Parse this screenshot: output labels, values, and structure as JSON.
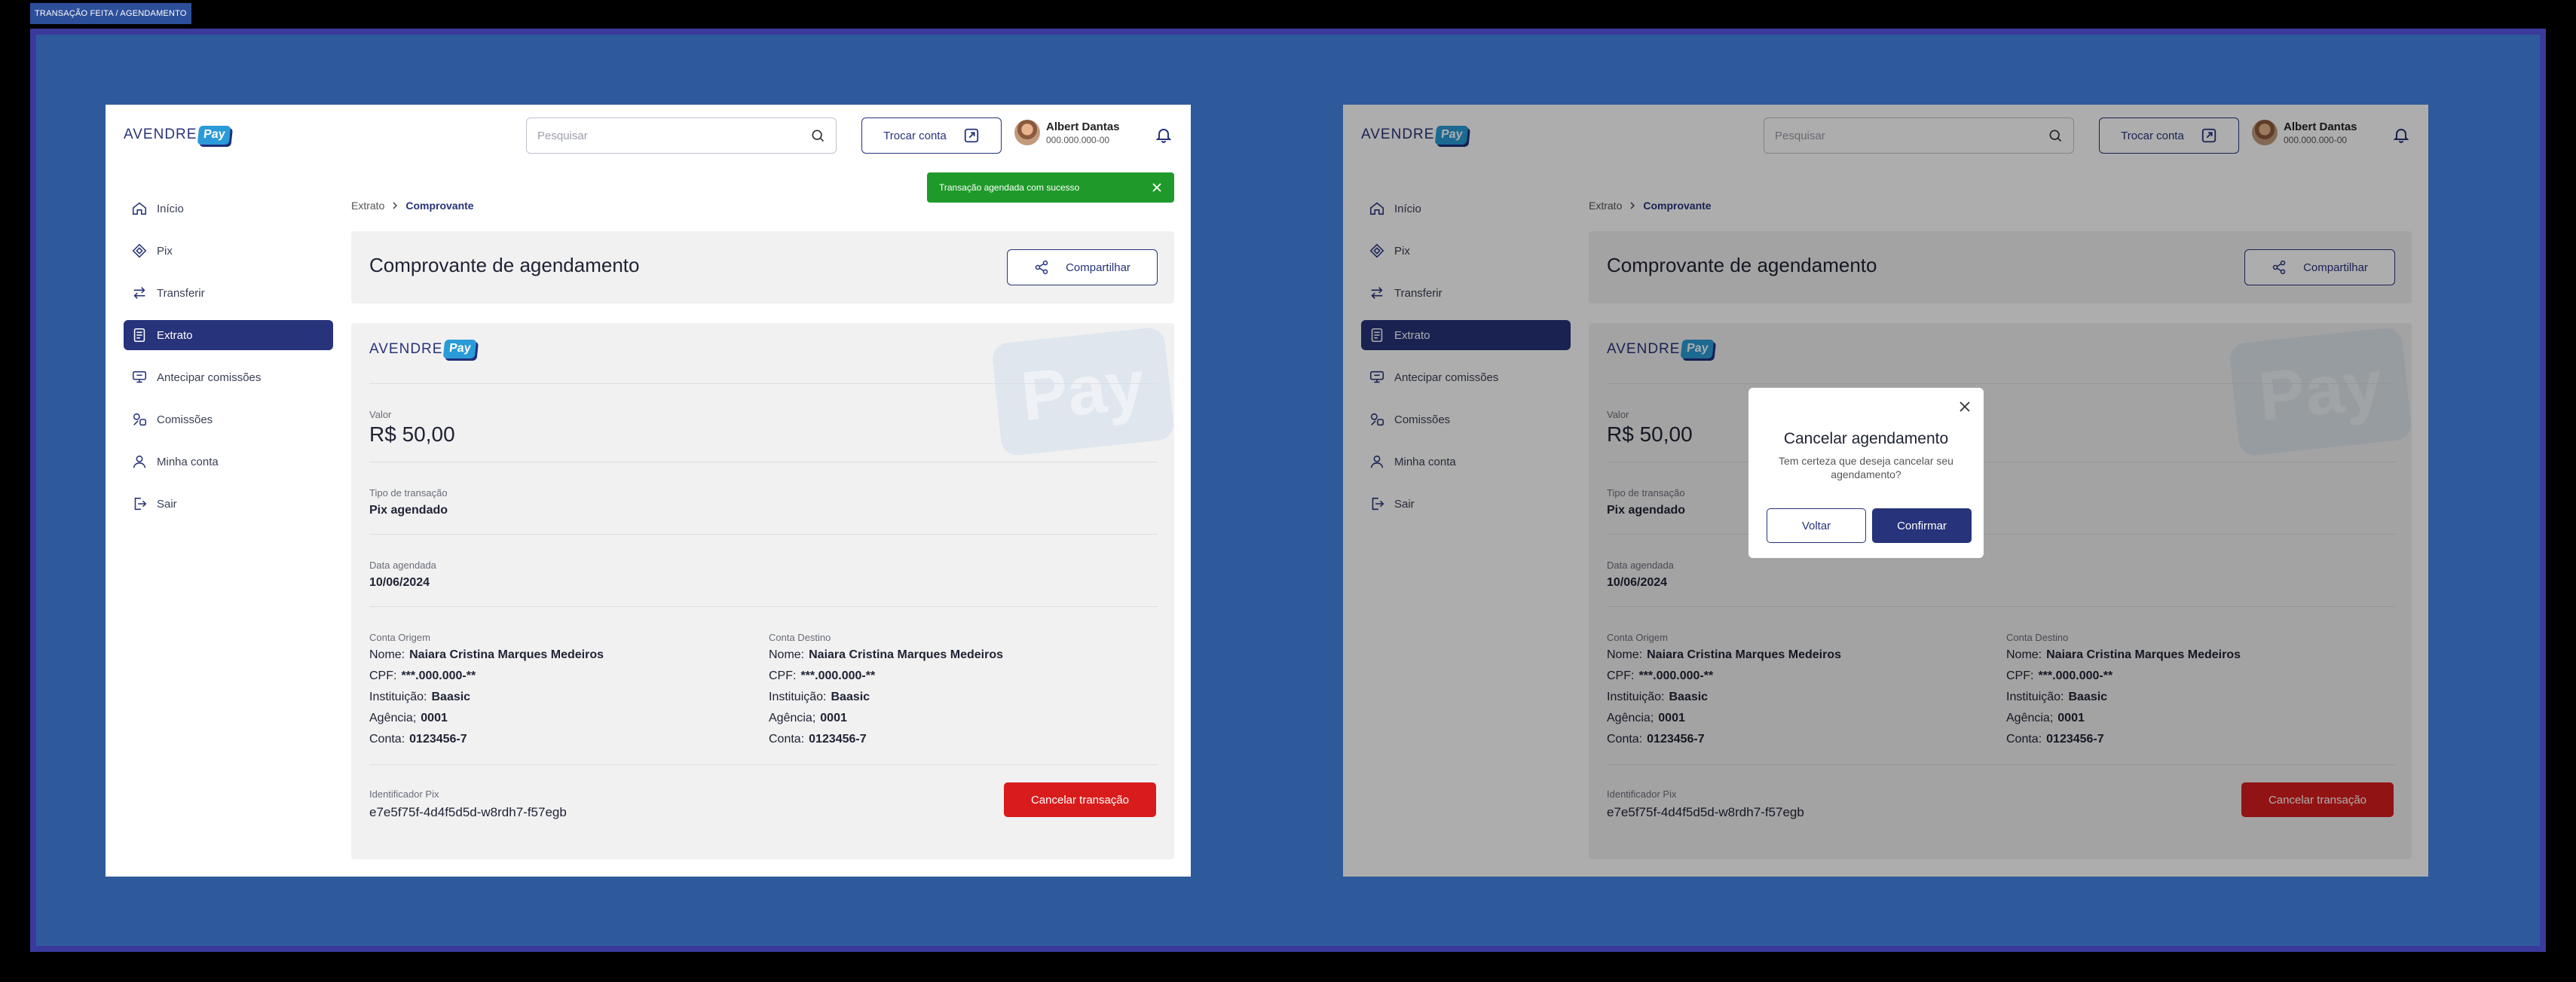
{
  "canvas_label": "TRANSAÇÃO FEITA / AGENDAMENTO",
  "header": {
    "logo_text": "AVENDRE",
    "logo_pay": "Pay",
    "search_placeholder": "Pesquisar",
    "switch_account_label": "Trocar conta",
    "user_name": "Albert Dantas",
    "user_document": "000.000.000-00"
  },
  "sidebar": {
    "items": [
      {
        "label": "Início",
        "icon": "home-icon"
      },
      {
        "label": "Pix",
        "icon": "pix-icon"
      },
      {
        "label": "Transferir",
        "icon": "transfer-icon"
      },
      {
        "label": "Extrato",
        "icon": "statement-icon",
        "active": true
      },
      {
        "label": "Antecipar comissões",
        "icon": "advance-icon"
      },
      {
        "label": "Comissões",
        "icon": "commission-icon"
      },
      {
        "label": "Minha conta",
        "icon": "user-icon"
      },
      {
        "label": "Sair",
        "icon": "logout-icon"
      }
    ]
  },
  "toast": {
    "message": "Transação agendada com sucesso"
  },
  "breadcrumb": {
    "parent": "Extrato",
    "current": "Comprovante"
  },
  "page_title": "Comprovante de agendamento",
  "share_label": "Compartilhar",
  "watermark_text": "Pay",
  "receipt": {
    "valor_label": "Valor",
    "valor": "R$ 50,00",
    "tipo_label": "Tipo de transação",
    "tipo": "Pix agendado",
    "data_label": "Data agendada",
    "data": "10/06/2024",
    "origem": {
      "title": "Conta Origem",
      "nome_label": "Nome:",
      "nome": "Naiara Cristina Marques Medeiros",
      "cpf_label": "CPF:",
      "cpf": "***.000.000-**",
      "instituicao_label": "Instituição:",
      "instituicao": "Baasic",
      "agencia_label": "Agência;",
      "agencia": "0001",
      "conta_label": "Conta:",
      "conta": "0123456-7"
    },
    "destino": {
      "title": "Conta Destino",
      "nome_label": "Nome:",
      "nome": "Naiara Cristina Marques Medeiros",
      "cpf_label": "CPF:",
      "cpf": "***.000.000-**",
      "instituicao_label": "Instituição:",
      "instituicao": "Baasic",
      "agencia_label": "Agência;",
      "agencia": "0001",
      "conta_label": "Conta:",
      "conta": "0123456-7"
    },
    "pix_id_label": "Identificador Pix",
    "pix_id": "e7e5f75f-4d4f5d5d-w8rdh7-f57egb",
    "cancel_label": "Cancelar transação"
  },
  "modal": {
    "title": "Cancelar agendamento",
    "text": "Tem certeza que deseja cancelar seu agendamento?",
    "back_label": "Voltar",
    "confirm_label": "Confirmar"
  },
  "colors": {
    "primary": "#27337a",
    "accent": "#2a9bd8",
    "danger": "#d81c1c",
    "success": "#1f9a2a",
    "board": "#2e5a9b"
  }
}
